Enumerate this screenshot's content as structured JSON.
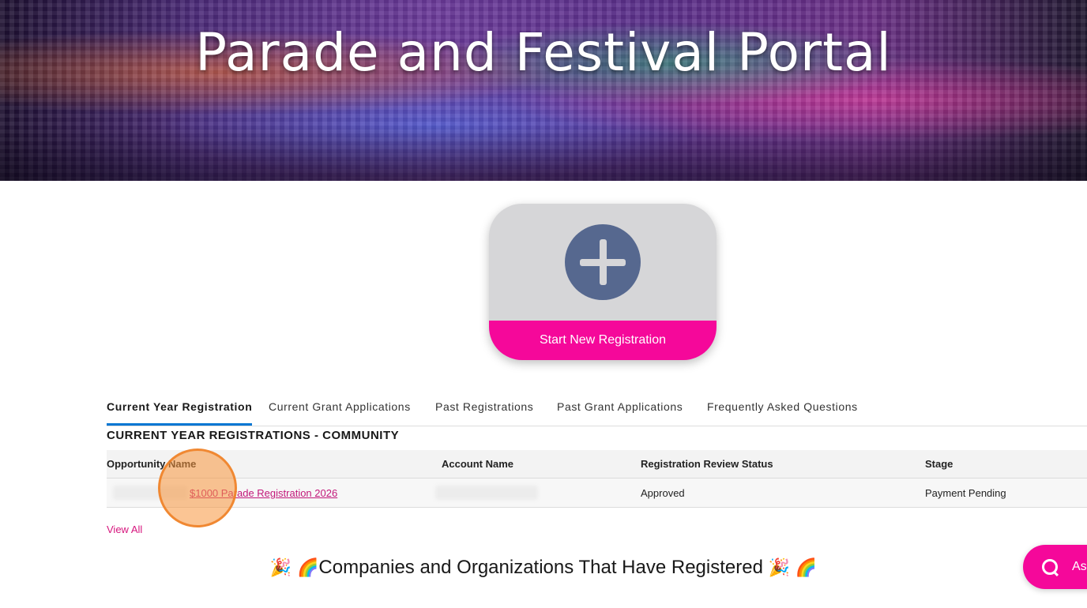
{
  "hero": {
    "title": "Parade and Festival Portal"
  },
  "start_tile": {
    "label": "Start New Registration",
    "icon": "plus-icon"
  },
  "tabs": [
    {
      "label": "Current Year Registration",
      "active": true
    },
    {
      "label": "Current Grant Applications",
      "active": false
    },
    {
      "label": "Past Registrations",
      "active": false
    },
    {
      "label": "Past Grant Applications",
      "active": false
    },
    {
      "label": "Frequently Asked Questions",
      "active": false
    }
  ],
  "section": {
    "title": "CURRENT YEAR REGISTRATIONS - COMMUNITY"
  },
  "table": {
    "columns": [
      "Opportunity Name",
      "Account Name",
      "Registration Review Status",
      "Stage"
    ],
    "rows": [
      {
        "opportunity": "$1000 Parade Registration 2026",
        "status": "Approved",
        "stage": "Payment Pending"
      }
    ]
  },
  "view_all": "View All",
  "companies": {
    "heading": "Companies and Organizations That Have Registered",
    "emoji_party": "🎉",
    "emoji_rainbow": "🌈"
  },
  "ask_button": {
    "label": "As",
    "icon": "chat-bubble-icon"
  },
  "colors": {
    "accent_pink": "#f5089a",
    "link": "#c2187a",
    "tab_underline": "#0176d3",
    "plus_circle": "#56688f"
  }
}
